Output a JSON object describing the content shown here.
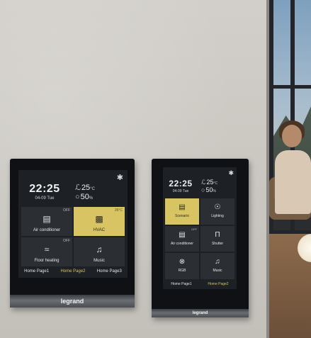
{
  "colors": {
    "active_tile": "#d8c462",
    "tile": "#2b2f34",
    "panel": "#0f1114"
  },
  "panel_left": {
    "time": "22:25",
    "date": "04-09 Tue",
    "temperature": "25",
    "temperature_unit": "°C",
    "humidity": "50",
    "humidity_unit": "%",
    "settings_icon": "settings-icon",
    "tiles": [
      {
        "label": "Air conditioner",
        "badge": "OFF",
        "icon": "air-conditioner-icon",
        "active": false
      },
      {
        "label": "HVAC",
        "badge": "26°C",
        "icon": "hvac-icon",
        "active": true
      },
      {
        "label": "Floor heating",
        "badge": "OFF",
        "icon": "floor-heating-icon",
        "active": false
      },
      {
        "label": "Music",
        "badge": "",
        "icon": "music-icon",
        "active": false
      }
    ],
    "nav": [
      "Home Page1",
      "Home Page2",
      "Home Page3"
    ],
    "nav_current": "Home Page2",
    "brand": "legrand"
  },
  "panel_right": {
    "time": "22:25",
    "date": "04-09 Tue",
    "temperature": "25",
    "temperature_unit": "°C",
    "humidity": "50",
    "humidity_unit": "%",
    "settings_icon": "settings-icon",
    "tiles": [
      {
        "label": "Scenario",
        "badge": "",
        "icon": "scenario-icon",
        "active": true
      },
      {
        "label": "Lighting",
        "badge": "",
        "icon": "lighting-icon",
        "active": false
      },
      {
        "label": "Air conditioner",
        "badge": "OFF",
        "icon": "air-conditioner-icon",
        "active": false
      },
      {
        "label": "Shutter",
        "badge": "",
        "icon": "shutter-icon",
        "active": false
      },
      {
        "label": "RGB",
        "badge": "",
        "icon": "rgb-icon",
        "active": false
      },
      {
        "label": "Music",
        "badge": "",
        "icon": "music-icon",
        "active": false
      }
    ],
    "nav": [
      "Home Page1",
      "Home Page2"
    ],
    "nav_current": "Home Page2",
    "brand": "legrand"
  }
}
